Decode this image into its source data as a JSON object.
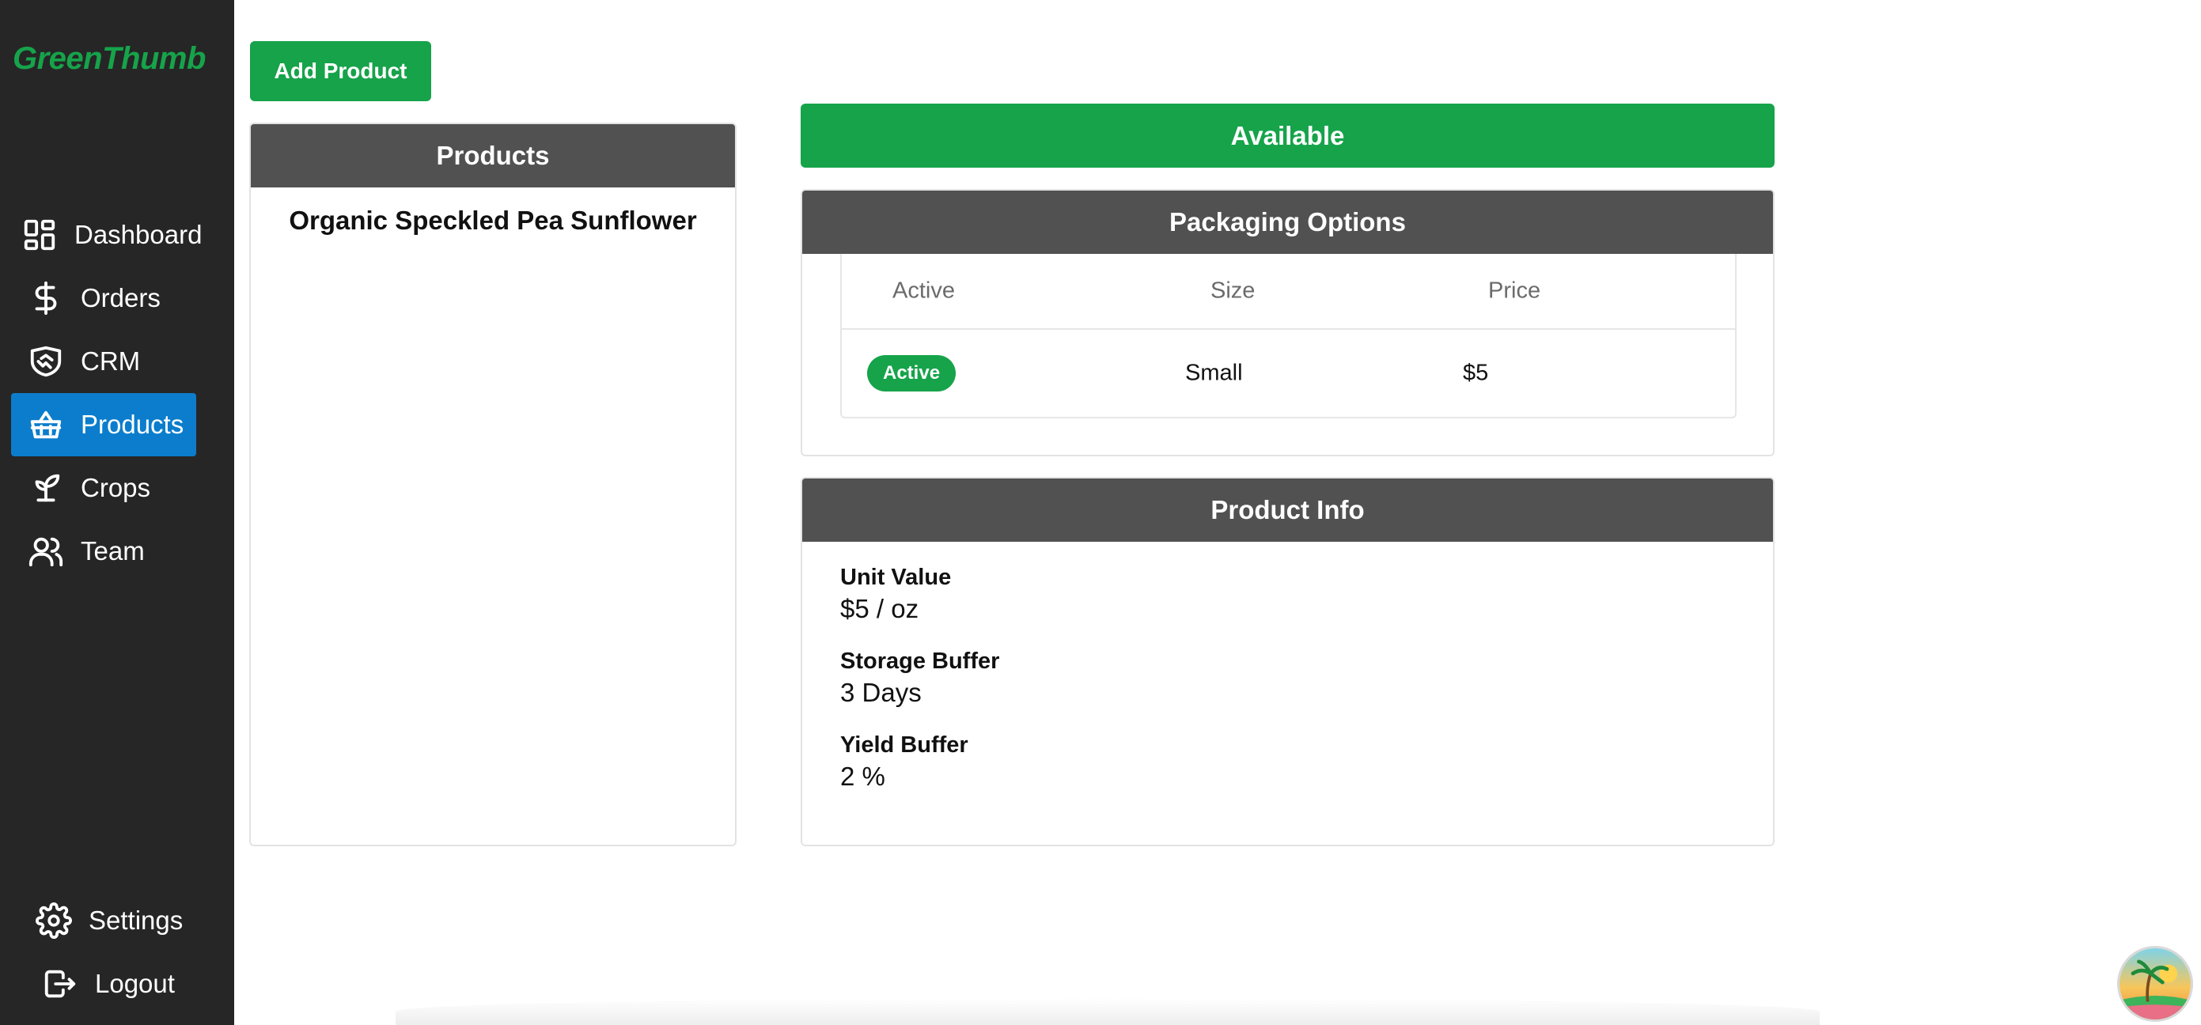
{
  "brand": "GreenThumb",
  "sidebar": {
    "items": [
      {
        "label": "Dashboard",
        "icon": "dashboard-icon"
      },
      {
        "label": "Orders",
        "icon": "dollar-icon"
      },
      {
        "label": "CRM",
        "icon": "handshake-icon"
      },
      {
        "label": "Products",
        "icon": "basket-icon",
        "active": true
      },
      {
        "label": "Crops",
        "icon": "sprout-icon"
      },
      {
        "label": "Team",
        "icon": "users-icon"
      }
    ],
    "bottom": [
      {
        "label": "Settings",
        "icon": "gear-icon"
      },
      {
        "label": "Logout",
        "icon": "logout-icon"
      }
    ]
  },
  "toolbar": {
    "add_label": "Add Product"
  },
  "products": {
    "title": "Products",
    "items": [
      "Organic Speckled Pea Sunflower"
    ]
  },
  "status": {
    "label": "Available",
    "color": "#16a34a"
  },
  "packaging": {
    "title": "Packaging Options",
    "columns": [
      "Active",
      "Size",
      "Price"
    ],
    "rows": [
      {
        "active": "Active",
        "size": "Small",
        "price": "$5"
      }
    ]
  },
  "product_info": {
    "title": "Product Info",
    "fields": [
      {
        "label": "Unit Value",
        "value": "$5 / oz"
      },
      {
        "label": "Storage Buffer",
        "value": "3 Days"
      },
      {
        "label": "Yield Buffer",
        "value": "2 %"
      }
    ]
  },
  "colors": {
    "accent": "#16a34a",
    "nav_active": "#0b7dcc",
    "sidebar_bg": "#262626",
    "header_bg": "#515151"
  }
}
